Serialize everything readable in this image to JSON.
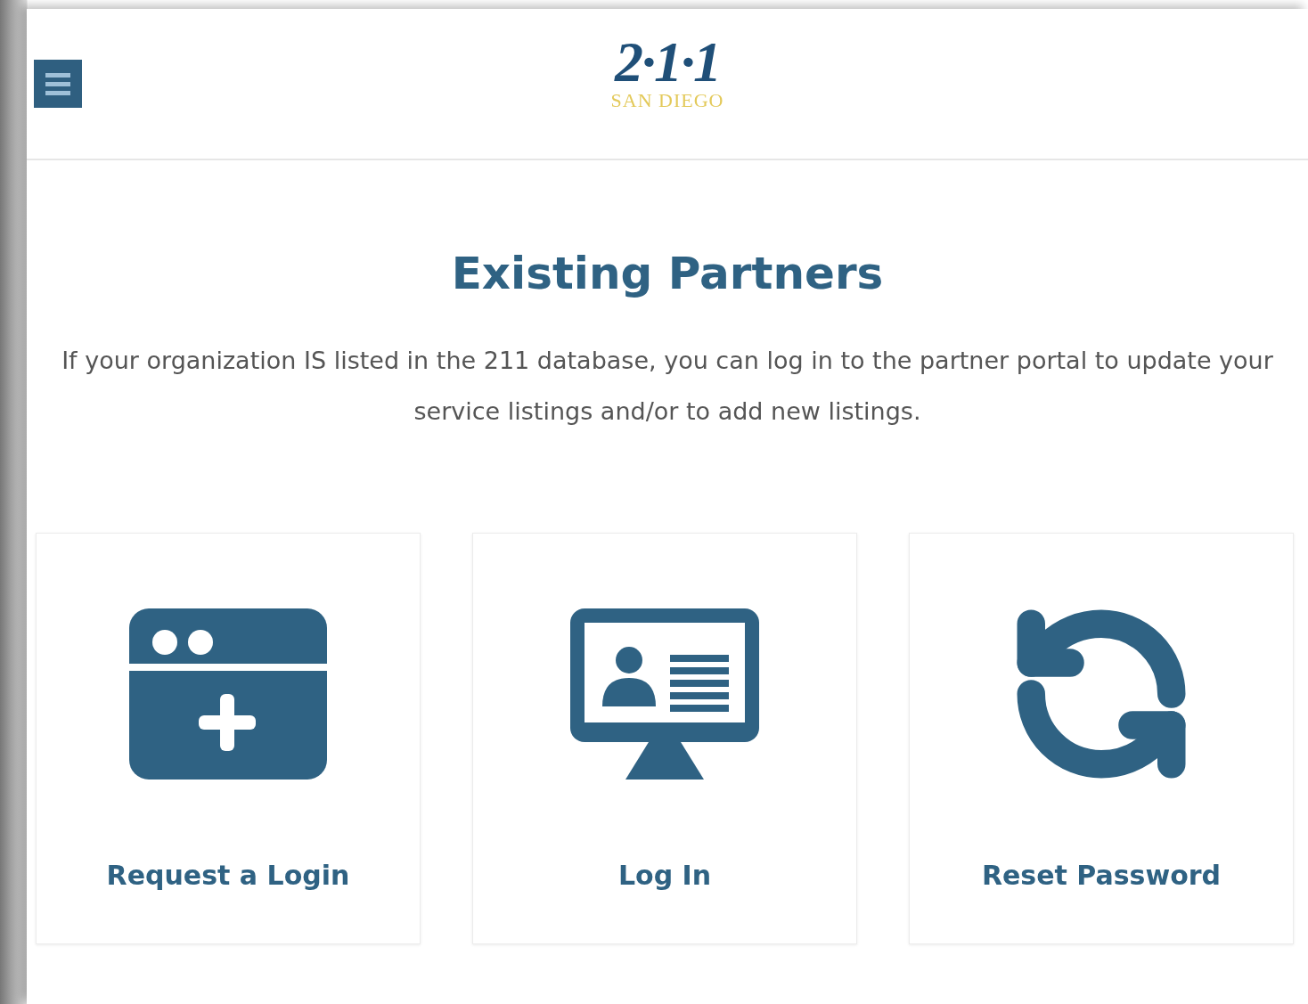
{
  "header": {
    "logo": {
      "mark": "2·1·1",
      "subtitle": "SAN DIEGO"
    }
  },
  "title": "Existing Partners",
  "description": "If your organization IS listed in the 211 database, you can log in to the partner portal to update your service listings and/or to add new listings.",
  "cards": [
    {
      "label": "Request a Login",
      "kind": "new-window"
    },
    {
      "label": "Log In",
      "kind": "profile-monitor"
    },
    {
      "label": "Reset Password",
      "kind": "refresh"
    }
  ]
}
